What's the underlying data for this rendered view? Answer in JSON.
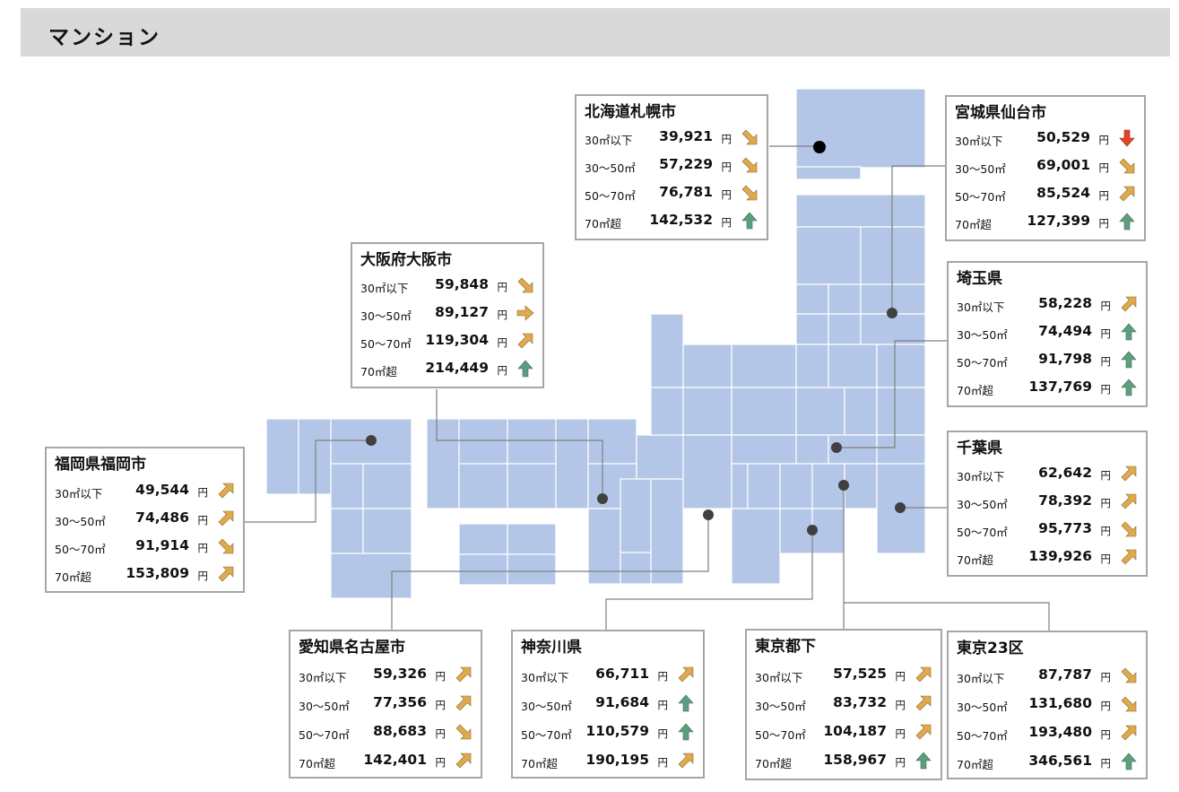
{
  "page": {
    "title": "マンション"
  },
  "colors": {
    "map_fill": "#b4c6e7",
    "map_edge": "#ffffff",
    "marker": "#404040",
    "connector": "#7f7f7f",
    "panel_border": "#a6a6a6",
    "header_bg": "#d9d9d9",
    "arrow_up": "#5d9e7e",
    "arrow_up_right": "#e0a94d",
    "arrow_right": "#e0a94d",
    "arrow_down_right": "#e0a94d",
    "arrow_down": "#e0452a"
  },
  "row_labels": [
    "30㎡以下",
    "30～50㎡",
    "50～70㎡",
    "70㎡超"
  ],
  "unit": "円",
  "regions": [
    {
      "id": "sapporo",
      "name": "北海道札幌市",
      "rows": [
        {
          "value": "39,921",
          "trend": "down-right"
        },
        {
          "value": "57,229",
          "trend": "down-right"
        },
        {
          "value": "76,781",
          "trend": "down-right"
        },
        {
          "value": "142,532",
          "trend": "up"
        }
      ]
    },
    {
      "id": "sendai",
      "name": "宮城県仙台市",
      "rows": [
        {
          "value": "50,529",
          "trend": "down"
        },
        {
          "value": "69,001",
          "trend": "down-right"
        },
        {
          "value": "85,524",
          "trend": "up-right"
        },
        {
          "value": "127,399",
          "trend": "up"
        }
      ]
    },
    {
      "id": "saitama",
      "name": "埼玉県",
      "rows": [
        {
          "value": "58,228",
          "trend": "up-right"
        },
        {
          "value": "74,494",
          "trend": "up"
        },
        {
          "value": "91,798",
          "trend": "up"
        },
        {
          "value": "137,769",
          "trend": "up"
        }
      ]
    },
    {
      "id": "chiba",
      "name": "千葉県",
      "rows": [
        {
          "value": "62,642",
          "trend": "up-right"
        },
        {
          "value": "78,392",
          "trend": "up-right"
        },
        {
          "value": "95,773",
          "trend": "down-right"
        },
        {
          "value": "139,926",
          "trend": "up-right"
        }
      ]
    },
    {
      "id": "osaka",
      "name": "大阪府大阪市",
      "rows": [
        {
          "value": "59,848",
          "trend": "down-right"
        },
        {
          "value": "89,127",
          "trend": "right"
        },
        {
          "value": "119,304",
          "trend": "up-right"
        },
        {
          "value": "214,449",
          "trend": "up"
        }
      ]
    },
    {
      "id": "fukuoka",
      "name": "福岡県福岡市",
      "rows": [
        {
          "value": "49,544",
          "trend": "up-right"
        },
        {
          "value": "74,486",
          "trend": "up-right"
        },
        {
          "value": "91,914",
          "trend": "down-right"
        },
        {
          "value": "153,809",
          "trend": "up-right"
        }
      ]
    },
    {
      "id": "nagoya",
      "name": "愛知県名古屋市",
      "rows": [
        {
          "value": "59,326",
          "trend": "up-right"
        },
        {
          "value": "77,356",
          "trend": "up-right"
        },
        {
          "value": "88,683",
          "trend": "down-right"
        },
        {
          "value": "142,401",
          "trend": "up-right"
        }
      ]
    },
    {
      "id": "kanagawa",
      "name": "神奈川県",
      "rows": [
        {
          "value": "66,711",
          "trend": "up-right"
        },
        {
          "value": "91,684",
          "trend": "up"
        },
        {
          "value": "110,579",
          "trend": "up"
        },
        {
          "value": "190,195",
          "trend": "up-right"
        }
      ]
    },
    {
      "id": "tokyo_suburb",
      "name": "東京都下",
      "rows": [
        {
          "value": "57,525",
          "trend": "up-right"
        },
        {
          "value": "83,732",
          "trend": "up-right"
        },
        {
          "value": "104,187",
          "trend": "up-right"
        },
        {
          "value": "158,967",
          "trend": "up"
        }
      ]
    },
    {
      "id": "tokyo23",
      "name": "東京23区",
      "rows": [
        {
          "value": "87,787",
          "trend": "down-right"
        },
        {
          "value": "131,680",
          "trend": "down-right"
        },
        {
          "value": "193,480",
          "trend": "up-right"
        },
        {
          "value": "346,561",
          "trend": "up"
        }
      ]
    }
  ]
}
